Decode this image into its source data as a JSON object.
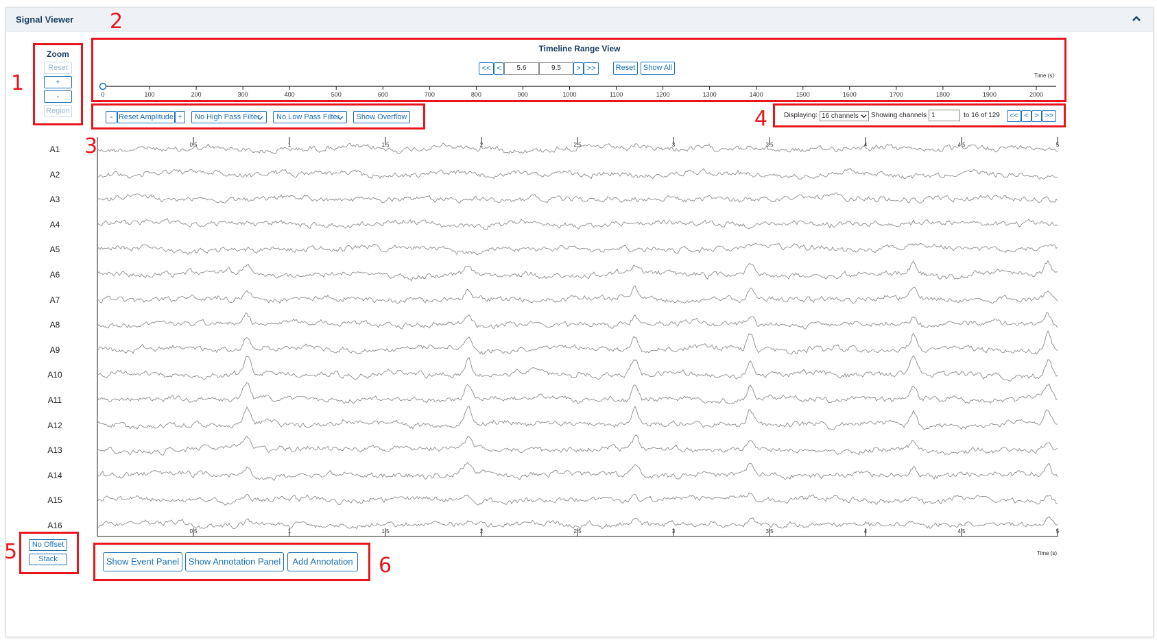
{
  "panel": {
    "title": "Signal Viewer",
    "collapse_icon": "chevron-up-icon"
  },
  "callouts": [
    "1",
    "2",
    "3",
    "4",
    "5",
    "6"
  ],
  "zoom": {
    "title": "Zoom",
    "reset": "Reset",
    "plus": "+",
    "minus": "-",
    "region": "Region"
  },
  "timeline": {
    "title": "Timeline Range View",
    "first": "<<",
    "prev": "<",
    "start": "5.6",
    "end": "9.5",
    "next": ">",
    "last": ">>",
    "reset": "Reset",
    "show_all": "Show All",
    "time_label": "Time (s)",
    "ticks": [
      "0",
      "100",
      "200",
      "300",
      "400",
      "500",
      "600",
      "700",
      "800",
      "900",
      "1000",
      "1100",
      "1200",
      "1300",
      "1400",
      "1500",
      "1600",
      "1700",
      "1800",
      "1900",
      "2000"
    ],
    "handle_value": 0
  },
  "toolbar": {
    "amp_minus": "-",
    "reset_amplitude": "Reset Amplitude",
    "amp_plus": "+",
    "high_pass": "No High Pass Filter",
    "low_pass": "No Low Pass Filter",
    "show_overflow": "Show Overflow"
  },
  "channels_nav": {
    "displaying_label": "Displaying:",
    "displaying_value": "16 channels",
    "showing_label": "Showing channels",
    "showing_value": "1",
    "range_text": "to 16 of 129",
    "first": "<<",
    "prev": "<",
    "next": ">",
    "last": ">>"
  },
  "signal": {
    "channels": [
      "A1",
      "A2",
      "A3",
      "A4",
      "A5",
      "A6",
      "A7",
      "A8",
      "A9",
      "A10",
      "A11",
      "A12",
      "A13",
      "A14",
      "A15",
      "A16"
    ],
    "x_ticks": [
      "0.5",
      "1",
      "1.5",
      "2",
      "2.5",
      "3",
      "3.5",
      "4",
      "4.5",
      "5"
    ],
    "time_label": "Time (s)",
    "trace_color": "#8c8c8c"
  },
  "offset": {
    "no_offset": "No Offset",
    "stack": "Stack"
  },
  "actions": {
    "show_event_panel": "Show Event Panel",
    "show_annotation_panel": "Show Annotation Panel",
    "add_annotation": "Add Annotation"
  },
  "colors": {
    "accent": "#1a70b8",
    "callout": "#e8161c",
    "header_bg": "#eef2f6"
  }
}
